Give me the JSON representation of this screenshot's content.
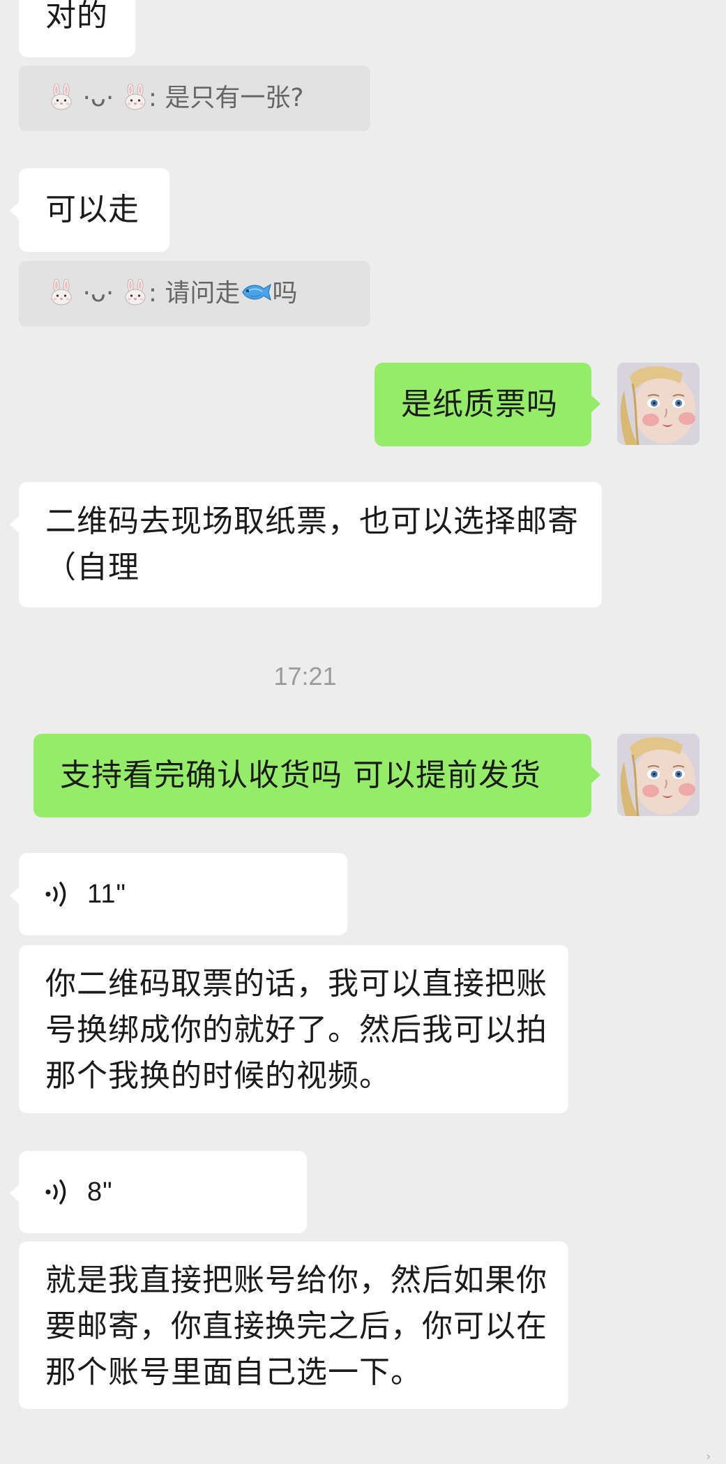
{
  "messages": {
    "m1": "对的",
    "q1": "是只有一张?",
    "m2": "可以走",
    "q2_before": "请问走",
    "q2_after": "吗",
    "m3": "是纸质票吗",
    "m4": "二维码去现场取纸票，也可以选择邮寄（自理",
    "time": "17:21",
    "m5": "支持看完确认收货吗 可以提前发货",
    "voice1": "11\"",
    "m6": "你二维码取票的话，我可以直接把账号换绑成你的就好了。然后我可以拍那个我换的时候的视频。",
    "voice2": "8\"",
    "m7": "就是我直接把账号给你，然后如果你要邮寄，你直接换完之后，你可以在那个账号里面自己选一下。"
  },
  "quote_sender": {
    "name_mid": "·ᴗ·",
    "separator": ":",
    "icon": "rabbit-face-emoji"
  },
  "icons": {
    "fish": "fish-emoji",
    "voice": "voice-wave-icon"
  },
  "colors": {
    "background": "#ededed",
    "incoming_bubble": "#ffffff",
    "outgoing_bubble": "#95ec69",
    "quote_bg": "#e2e2e2",
    "timestamp": "#9a9a9a"
  }
}
